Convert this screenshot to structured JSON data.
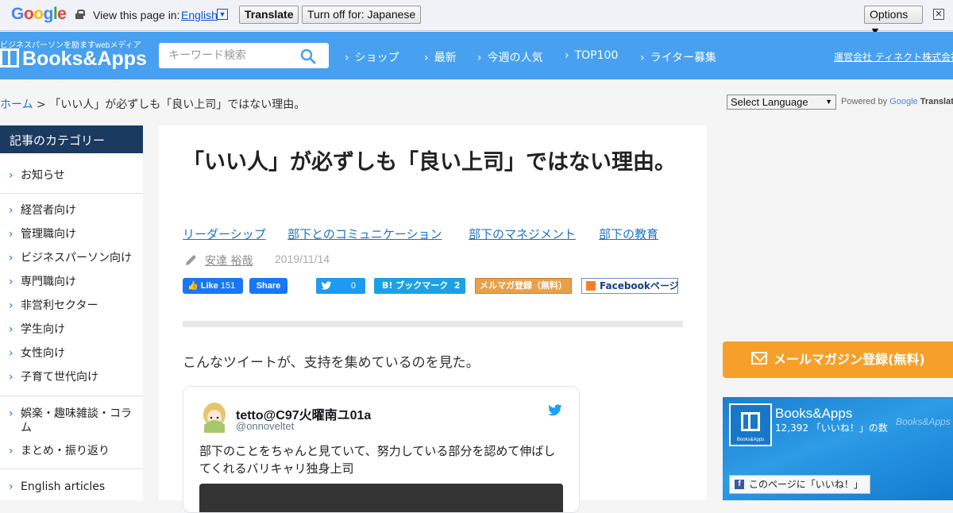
{
  "translate_bar": {
    "logo": "Google",
    "view_text": "View this page in:",
    "language": "English",
    "translate_label": "Translate",
    "turn_off_label": "Turn off for: Japanese",
    "options_label": "Options ▼",
    "close_glyph": "✕"
  },
  "header": {
    "tagline": "ビジネスパーソンを励ますwebメディア",
    "logo_text": "Books&Apps",
    "search_placeholder": "キーワード検索",
    "nav": [
      "ショップ",
      "最新",
      "今週の人気",
      "TOP100",
      "ライター募集"
    ],
    "company_link": "運営会社 ティネクト株式会社",
    "bg_color": "#47a0f0"
  },
  "breadcrumb": {
    "home": "ホーム",
    "separator": " > ",
    "current": "「いい人」が必ずしも「良い上司」ではない理由。"
  },
  "translate_widget": {
    "select_label": "Select Language",
    "powered_by": "Powered by",
    "google": "Google",
    "translate": "Translate"
  },
  "sidebar": {
    "heading": "記事のカテゴリー",
    "items": [
      "お知らせ",
      "経営者向け",
      "管理職向け",
      "ビジネスパーソン向け",
      "専門職向け",
      "非営利セクター",
      "学生向け",
      "女性向け",
      "子育て世代向け",
      "娯楽・趣味雑談・コラム",
      "まとめ・振り返り",
      "English articles"
    ]
  },
  "article": {
    "title": "「いい人」が必ずしも「良い上司」ではない理由。",
    "tags": [
      "リーダーシップ",
      "部下とのコミュニケーション",
      "部下のマネジメント",
      "部下の教育"
    ],
    "author": "安達 裕哉",
    "date": "2019/11/14",
    "share": {
      "fb_like": "Like",
      "fb_like_count": "151",
      "fb_share": "Share",
      "tweet_count": "0",
      "hatena_label": "B! ブックマーク",
      "hatena_count": "2",
      "mail_label": "メルマガ登録（無料）",
      "fbpage_label": "Facebookページ"
    },
    "lead": "こんなツイートが、支持を集めているのを見た。",
    "tweet": {
      "name": "tetto@C97火曜南ユ01a",
      "handle": "@onnoveltet",
      "text": "部下のことをちゃんと見ていて、努力している部分を認めて伸ばしてくれるバリキャリ独身上司"
    }
  },
  "right": {
    "mail_banner": "メールマガジン登録(無料)",
    "fb_page_name": "Books&Apps",
    "fb_likes": "12,392 「いいね！」の数",
    "fb_thumb_text": "Books&Apps",
    "fb_watermark": "Books&Apps",
    "fb_like_page": "このページに「いいね！」"
  }
}
